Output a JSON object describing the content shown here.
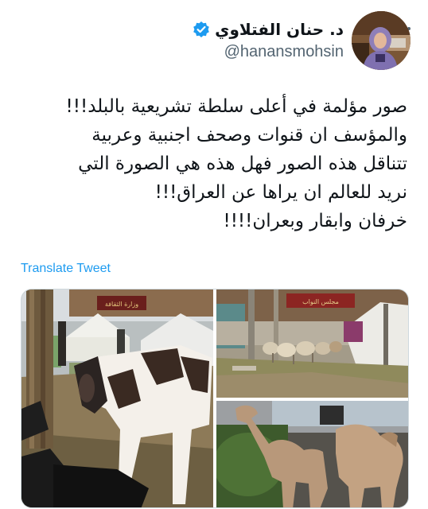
{
  "author": {
    "display_name": "د. حنان الفتلاوي",
    "handle": "@hanansmohsin",
    "verified": true,
    "avatar_icon": "profile-photo"
  },
  "tweet": {
    "text": "صور مؤلمة في أعلى سلطة تشريعية بالبلد!!!\nوالمؤسف ان قنوات وصحف اجنبية وعربية\nتتناقل هذه الصور فهل هذه هي الصورة التي\nنريد للعالم ان يراها عن العراق!!!\nخرفان وابقار وبعران!!!!",
    "translate_label": "Translate Tweet"
  },
  "media": {
    "images": [
      {
        "name": "cows-photo",
        "sign": "وزارة الثقافة"
      },
      {
        "name": "sheep-photo",
        "sign": "مجلس النواب"
      },
      {
        "name": "camels-photo"
      }
    ]
  },
  "colors": {
    "accent": "#1d9bf0",
    "text": "#0f1419",
    "secondary": "#536471",
    "border": "#cfd9de"
  }
}
